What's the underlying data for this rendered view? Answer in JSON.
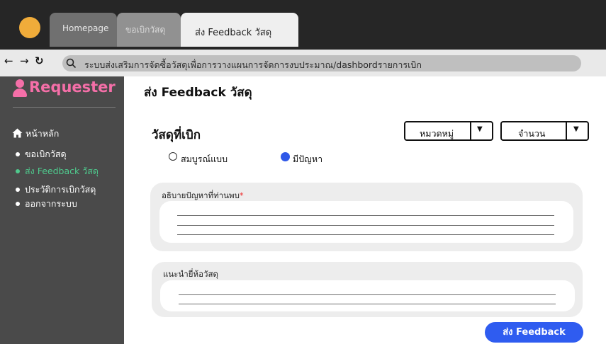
{
  "browser": {
    "tabs": [
      {
        "label": "Homepage"
      },
      {
        "label": "ขอเบิกวัสดุ"
      },
      {
        "label": "ส่ง Feedback วัสดุ"
      }
    ],
    "nav_icons": [
      "back-arrow-icon",
      "forward-arrow-icon",
      "refresh-icon"
    ],
    "url": "ระบบส่งเสริมการจัดซื้อวัสดุเพื่อการวางแผนการจัดการงบประมาณ/dashbordรายการเบิก"
  },
  "sidebar": {
    "brand": "Requester",
    "home_label": "หน้าหลัก",
    "items": [
      {
        "label": "ขอเบิกวัสดุ",
        "active": false
      },
      {
        "label": "ส่ง Feedback วัสดุ",
        "active": true
      },
      {
        "label": "ประวัติการเบิกวัสดุ",
        "active": false
      },
      {
        "label": "ออกจากระบบ",
        "active": false
      }
    ],
    "active_color": "#4fc98d",
    "brand_color": "#f56fa8"
  },
  "main": {
    "page_title": "ส่ง Feedback วัสดุ",
    "section_title": "วัสดุที่เบิก",
    "category_dropdown": "หมวดหมู่",
    "quantity_dropdown": "จำนวน",
    "radio_options": [
      {
        "label": "สมบูรณ์แบบ",
        "selected": false
      },
      {
        "label": "มีปัญหา",
        "selected": true
      }
    ],
    "problem_field": {
      "label": "อธิบายปัญหาที่ท่านพบ",
      "required_mark": "*"
    },
    "suggest_field": {
      "label": "แนะนำยี่ห้อวัสดุ"
    },
    "submit_label": "ส่ง Feedback",
    "accent_color": "#2f5cf0"
  }
}
